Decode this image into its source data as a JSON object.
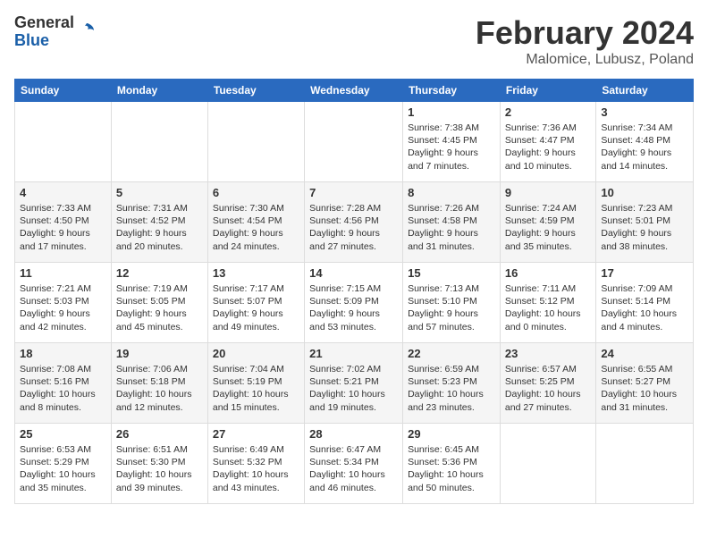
{
  "header": {
    "logo": {
      "general": "General",
      "blue": "Blue"
    },
    "title": "February 2024",
    "location": "Malomice, Lubusz, Poland"
  },
  "columns": [
    "Sunday",
    "Monday",
    "Tuesday",
    "Wednesday",
    "Thursday",
    "Friday",
    "Saturday"
  ],
  "weeks": [
    [
      {
        "num": "",
        "info": ""
      },
      {
        "num": "",
        "info": ""
      },
      {
        "num": "",
        "info": ""
      },
      {
        "num": "",
        "info": ""
      },
      {
        "num": "1",
        "info": "Sunrise: 7:38 AM\nSunset: 4:45 PM\nDaylight: 9 hours\nand 7 minutes."
      },
      {
        "num": "2",
        "info": "Sunrise: 7:36 AM\nSunset: 4:47 PM\nDaylight: 9 hours\nand 10 minutes."
      },
      {
        "num": "3",
        "info": "Sunrise: 7:34 AM\nSunset: 4:48 PM\nDaylight: 9 hours\nand 14 minutes."
      }
    ],
    [
      {
        "num": "4",
        "info": "Sunrise: 7:33 AM\nSunset: 4:50 PM\nDaylight: 9 hours\nand 17 minutes."
      },
      {
        "num": "5",
        "info": "Sunrise: 7:31 AM\nSunset: 4:52 PM\nDaylight: 9 hours\nand 20 minutes."
      },
      {
        "num": "6",
        "info": "Sunrise: 7:30 AM\nSunset: 4:54 PM\nDaylight: 9 hours\nand 24 minutes."
      },
      {
        "num": "7",
        "info": "Sunrise: 7:28 AM\nSunset: 4:56 PM\nDaylight: 9 hours\nand 27 minutes."
      },
      {
        "num": "8",
        "info": "Sunrise: 7:26 AM\nSunset: 4:58 PM\nDaylight: 9 hours\nand 31 minutes."
      },
      {
        "num": "9",
        "info": "Sunrise: 7:24 AM\nSunset: 4:59 PM\nDaylight: 9 hours\nand 35 minutes."
      },
      {
        "num": "10",
        "info": "Sunrise: 7:23 AM\nSunset: 5:01 PM\nDaylight: 9 hours\nand 38 minutes."
      }
    ],
    [
      {
        "num": "11",
        "info": "Sunrise: 7:21 AM\nSunset: 5:03 PM\nDaylight: 9 hours\nand 42 minutes."
      },
      {
        "num": "12",
        "info": "Sunrise: 7:19 AM\nSunset: 5:05 PM\nDaylight: 9 hours\nand 45 minutes."
      },
      {
        "num": "13",
        "info": "Sunrise: 7:17 AM\nSunset: 5:07 PM\nDaylight: 9 hours\nand 49 minutes."
      },
      {
        "num": "14",
        "info": "Sunrise: 7:15 AM\nSunset: 5:09 PM\nDaylight: 9 hours\nand 53 minutes."
      },
      {
        "num": "15",
        "info": "Sunrise: 7:13 AM\nSunset: 5:10 PM\nDaylight: 9 hours\nand 57 minutes."
      },
      {
        "num": "16",
        "info": "Sunrise: 7:11 AM\nSunset: 5:12 PM\nDaylight: 10 hours\nand 0 minutes."
      },
      {
        "num": "17",
        "info": "Sunrise: 7:09 AM\nSunset: 5:14 PM\nDaylight: 10 hours\nand 4 minutes."
      }
    ],
    [
      {
        "num": "18",
        "info": "Sunrise: 7:08 AM\nSunset: 5:16 PM\nDaylight: 10 hours\nand 8 minutes."
      },
      {
        "num": "19",
        "info": "Sunrise: 7:06 AM\nSunset: 5:18 PM\nDaylight: 10 hours\nand 12 minutes."
      },
      {
        "num": "20",
        "info": "Sunrise: 7:04 AM\nSunset: 5:19 PM\nDaylight: 10 hours\nand 15 minutes."
      },
      {
        "num": "21",
        "info": "Sunrise: 7:02 AM\nSunset: 5:21 PM\nDaylight: 10 hours\nand 19 minutes."
      },
      {
        "num": "22",
        "info": "Sunrise: 6:59 AM\nSunset: 5:23 PM\nDaylight: 10 hours\nand 23 minutes."
      },
      {
        "num": "23",
        "info": "Sunrise: 6:57 AM\nSunset: 5:25 PM\nDaylight: 10 hours\nand 27 minutes."
      },
      {
        "num": "24",
        "info": "Sunrise: 6:55 AM\nSunset: 5:27 PM\nDaylight: 10 hours\nand 31 minutes."
      }
    ],
    [
      {
        "num": "25",
        "info": "Sunrise: 6:53 AM\nSunset: 5:29 PM\nDaylight: 10 hours\nand 35 minutes."
      },
      {
        "num": "26",
        "info": "Sunrise: 6:51 AM\nSunset: 5:30 PM\nDaylight: 10 hours\nand 39 minutes."
      },
      {
        "num": "27",
        "info": "Sunrise: 6:49 AM\nSunset: 5:32 PM\nDaylight: 10 hours\nand 43 minutes."
      },
      {
        "num": "28",
        "info": "Sunrise: 6:47 AM\nSunset: 5:34 PM\nDaylight: 10 hours\nand 46 minutes."
      },
      {
        "num": "29",
        "info": "Sunrise: 6:45 AM\nSunset: 5:36 PM\nDaylight: 10 hours\nand 50 minutes."
      },
      {
        "num": "",
        "info": ""
      },
      {
        "num": "",
        "info": ""
      }
    ]
  ]
}
